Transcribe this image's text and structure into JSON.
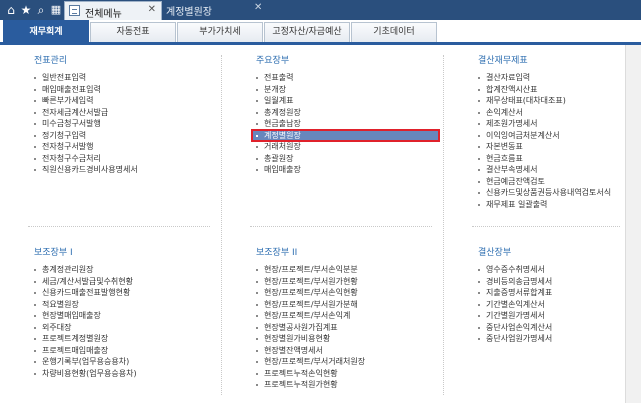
{
  "topbar": {
    "icons": [
      "home-icon",
      "star-icon",
      "search-icon",
      "grid-menu-icon"
    ],
    "tabs": [
      {
        "label": "전체메뉴",
        "active": true
      },
      {
        "label": "계정별원장",
        "active": false
      }
    ],
    "close_symbol": "✕"
  },
  "category_tabs": [
    {
      "label": "재무회계",
      "active": true
    },
    {
      "label": "자동전표",
      "active": false
    },
    {
      "label": "부가가치세",
      "active": false
    },
    {
      "label": "고정자산/자금예산",
      "active": false
    },
    {
      "label": "기초데이터",
      "active": false
    }
  ],
  "sections": {
    "voucher": {
      "title": "전표관리",
      "items": [
        "일반전표입력",
        "매입매출전표입력",
        "빠른부가세입력",
        "전자세금계산서발급",
        "미수금청구서발행",
        "정기청구입력",
        "전자청구서발행",
        "전자청구수금처리",
        "직원신용카드경비사용명세서"
      ]
    },
    "main_books": {
      "title": "주요장부",
      "items": [
        "전표출력",
        "분개장",
        "일월계표",
        "총계정원장",
        "현금출납장",
        "계정별원장",
        "거래처원장",
        "총괄원장",
        "매입매출장"
      ],
      "selected_index": 5
    },
    "closing": {
      "title": "결산재무제표",
      "items": [
        "결산자료입력",
        "합계잔액시산표",
        "재무상태표(대차대조표)",
        "손익계산서",
        "제조원가명세서",
        "이익잉여금처분계산서",
        "자본변동표",
        "현금흐름표",
        "결산부속명세서",
        "현금예금잔액검토",
        "신용카드및상품권등사용내역검토서식",
        "재무제표 일괄출력"
      ]
    },
    "aux1": {
      "title": "보조장부 I",
      "items": [
        "총계정관리원장",
        "세금/계산서발급및수취현황",
        "신용카드매출전표발행현황",
        "적요별원장",
        "현장별매입매출장",
        "외주대장",
        "프로젝트계정별원장",
        "프로젝트매입매출장",
        "운행기록부(업무용승용차)",
        "차량비용현황(업무용승용차)"
      ]
    },
    "aux2": {
      "title": "보조장부 II",
      "items": [
        "현장/프로젝트/부서손익분분",
        "현장/프로젝트/부서원가현황",
        "현장/프로젝트/부서손익현황",
        "현장/프로젝트/부서원가분해",
        "현장/프로젝트/부서손익계",
        "현장별공사원가집계표",
        "현장별원가비용현황",
        "현장별잔액명세서",
        "현장/프로젝트/부서거래처원장",
        "프로젝트누적손익현황",
        "프로젝트누적원가현황"
      ]
    },
    "settlement": {
      "title": "결산장부",
      "items": [
        "영수증수취명세서",
        "경비등의송금명세서",
        "지출증명서류합계표",
        "기간별손익계산서",
        "기간별원가명세서",
        "중단사업손익계산서",
        "중단사업원가명세서"
      ]
    }
  }
}
